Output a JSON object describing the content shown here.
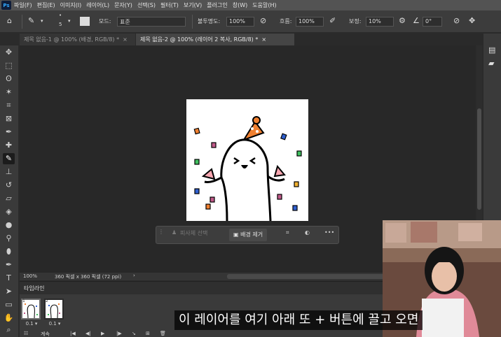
{
  "menu": {
    "logo": "Ps",
    "items": [
      "파일(F)",
      "편집(E)",
      "이미지(I)",
      "레이어(L)",
      "문자(Y)",
      "선택(S)",
      "필터(T)",
      "보기(V)",
      "플러그인",
      "창(W)",
      "도움말(H)"
    ]
  },
  "options": {
    "brush_size": "5",
    "mode_label": "모드:",
    "mode_value": "표준",
    "opacity_label": "불투명도:",
    "opacity_value": "100%",
    "flow_label": "흐름:",
    "flow_value": "100%",
    "smoothing_label": "보정:",
    "smoothing_value": "10%",
    "angle_value": "0°"
  },
  "tabs": [
    {
      "label": "제목 없음-1 @ 100% (배경, RGB/8) *",
      "active": false
    },
    {
      "label": "제목 없음-2 @ 100% (레이어 2 복사, RGB/8) *",
      "active": true
    }
  ],
  "taskbar": {
    "select_subject": "피사체 선택",
    "remove_background": "배경 제거",
    "more": "•••"
  },
  "status": {
    "zoom": "100%",
    "doc_info": "360 픽셀 x 360 픽셀 (72 ppi)",
    "arrow": "›"
  },
  "timeline": {
    "title": "타임라인",
    "frames": [
      {
        "number": "1",
        "delay": "0.1 ▾",
        "selected": true
      },
      {
        "number": "2",
        "delay": "0.1 ▾",
        "selected": false
      }
    ],
    "loop": "계속"
  },
  "subtitle": "이 레이어를 여기 아래 또 + 버튼에 끌고 오면",
  "colors": {
    "accent": "#31a8ff",
    "hat_orange": "#f08030",
    "confetti_pink": "#f7a6b0"
  }
}
